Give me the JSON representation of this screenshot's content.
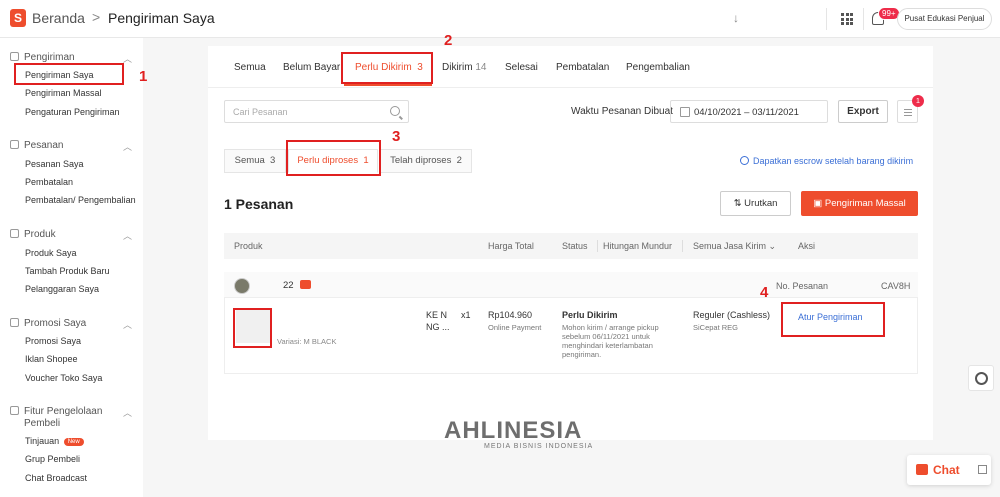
{
  "header": {
    "logo_letter": "S",
    "breadcrumb_home": "Beranda",
    "breadcrumb_separator": ">",
    "breadcrumb_current": "Pengiriman Saya",
    "arrow": "↓",
    "notif_badge": "99+",
    "edu_button": "Pusat Edukasi Penjual"
  },
  "sidebar": {
    "sections": [
      {
        "title": "Pengiriman",
        "items": [
          "Pengiriman Saya",
          "Pengiriman Massal",
          "Pengaturan Pengiriman"
        ]
      },
      {
        "title": "Pesanan",
        "items": [
          "Pesanan Saya",
          "Pembatalan",
          "Pembatalan/ Pengembalian"
        ]
      },
      {
        "title": "Produk",
        "items": [
          "Produk Saya",
          "Tambah Produk Baru",
          "Pelanggaran Saya"
        ]
      },
      {
        "title": "Promosi Saya",
        "items": [
          "Promosi Saya",
          "Iklan Shopee",
          "Voucher Toko Saya"
        ]
      },
      {
        "title_line1": "Fitur Pengelolaan",
        "title_line2": "Pembeli",
        "items": [
          "Tinjauan",
          "Grup Pembeli",
          "Chat Broadcast"
        ],
        "new_badge": "New"
      }
    ]
  },
  "tabs": {
    "all": "Semua",
    "unpaid": "Belum Bayar",
    "to_ship": "Perlu Dikirim",
    "to_ship_count": "3",
    "shipped": "Dikirim",
    "shipped_count": "14",
    "completed": "Selesai",
    "cancelled": "Pembatalan",
    "returns": "Pengembalian"
  },
  "filters": {
    "search_placeholder": "Cari Pesanan",
    "date_label": "Waktu Pesanan Dibuat",
    "date_range": "04/10/2021 – 03/11/2021",
    "export": "Export",
    "menu_badge": "1"
  },
  "subtabs": {
    "all": "Semua",
    "all_count": "3",
    "to_process": "Perlu diproses",
    "to_process_count": "1",
    "processed": "Telah diproses",
    "processed_count": "2",
    "escrow_link": "Dapatkan escrow setelah barang dikirim"
  },
  "orders": {
    "count_title": "1 Pesanan",
    "sort_button": "Urutkan",
    "mass_button": "Pengiriman Massal",
    "columns": {
      "product": "Produk",
      "total": "Harga Total",
      "status": "Status",
      "countdown": "Hitungan Mundur",
      "courier": "Semua Jasa Kirim",
      "action": "Aksi"
    },
    "row": {
      "buyer_num": "22",
      "order_no_label": "No. Pesanan",
      "order_no_tail": "CAV8H",
      "variation": "Variasi: M BLACK",
      "product_frag1": "KE N",
      "product_frag2": "NG ...",
      "qty": "x1",
      "price": "Rp104.960",
      "payment": "Online Payment",
      "status": "Perlu Dikirim",
      "status_note": "Mohon kirim / arrange pickup sebelum 06/11/2021 untuk menghindari keterlambatan pengiriman.",
      "courier": "Reguler (Cashless)",
      "courier_sub": "SiCepat REG",
      "action": "Atur Pengiriman"
    }
  },
  "annotations": [
    "1",
    "2",
    "3",
    "4"
  ],
  "floating": {
    "chat": "Chat"
  },
  "watermark": {
    "brand": "AHLINESIA",
    "tagline": "MEDIA BISNIS INDONESIA"
  },
  "colors": {
    "brand": "#ee4d2d",
    "link": "#3b6fd6",
    "annotation": "#e02020"
  }
}
